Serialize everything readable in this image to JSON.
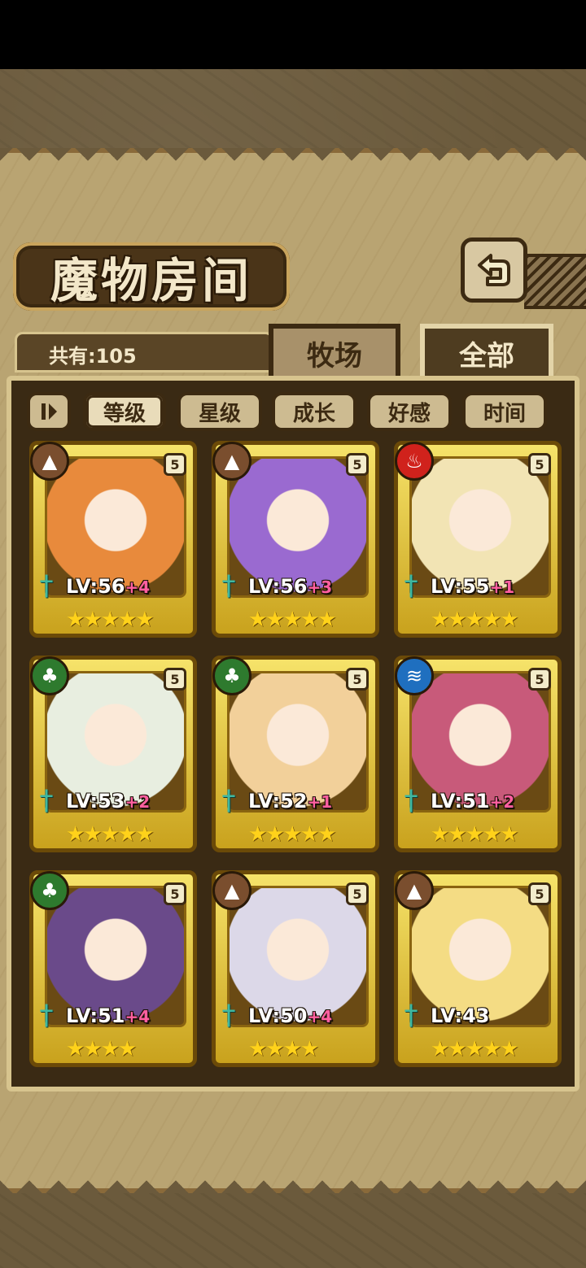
{
  "title": "魔物房间",
  "count_label": "共有:105",
  "tabs": {
    "farm": "牧场",
    "all": "全部"
  },
  "sort": {
    "options": [
      "等级",
      "星级",
      "成长",
      "好感",
      "时间"
    ],
    "active": "等级"
  },
  "colors": {
    "earth": "#7a4e2e",
    "fire": "#d0221c",
    "grass": "#2e7a2e",
    "water": "#1f6fbf"
  },
  "monsters": [
    {
      "level": "LV:56",
      "bonus": "+4",
      "element": "earth-icon",
      "stars": "★★★★★",
      "grade": "5",
      "portrait_color": "#e88a3c"
    },
    {
      "level": "LV:56",
      "bonus": "+3",
      "element": "earth-icon",
      "stars": "★★★★★",
      "grade": "5",
      "portrait_color": "#9a6ad0"
    },
    {
      "level": "LV:55",
      "bonus": "+1",
      "element": "fire-icon",
      "stars": "★★★★★",
      "grade": "5",
      "portrait_color": "#f2e4b4"
    },
    {
      "level": "LV:53",
      "bonus": "+2",
      "element": "grass-icon",
      "stars": "★★★★★",
      "grade": "5",
      "portrait_color": "#e8eee0"
    },
    {
      "level": "LV:52",
      "bonus": "+1",
      "element": "grass-icon",
      "stars": "★★★★★",
      "grade": "5",
      "portrait_color": "#f2d09a"
    },
    {
      "level": "LV:51",
      "bonus": "+2",
      "element": "water-icon",
      "stars": "★★★★★",
      "grade": "5",
      "portrait_color": "#c85a7a"
    },
    {
      "level": "LV:51",
      "bonus": "+4",
      "element": "grass-icon",
      "stars": "★★★★",
      "grade": "5",
      "portrait_color": "#6a4a8a"
    },
    {
      "level": "LV:50",
      "bonus": "+4",
      "element": "earth-icon",
      "stars": "★★★★",
      "grade": "5",
      "portrait_color": "#dcd8e8"
    },
    {
      "level": "LV:43",
      "bonus": "",
      "element": "earth-icon",
      "stars": "★★★★★",
      "grade": "5",
      "portrait_color": "#f4dc84"
    }
  ]
}
